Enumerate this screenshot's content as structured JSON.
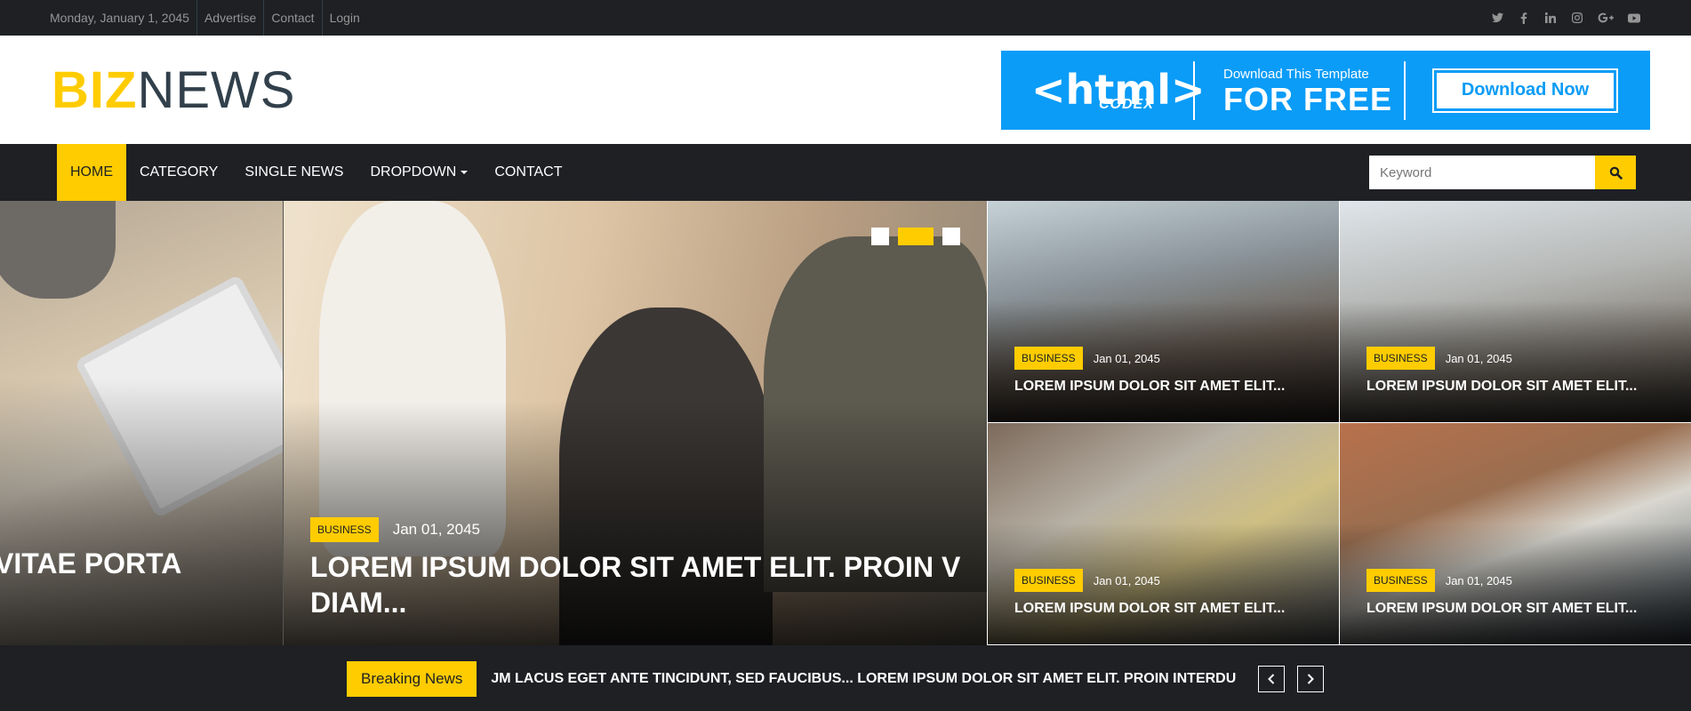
{
  "topbar": {
    "date": "Monday, January 1, 2045",
    "links": [
      "Advertise",
      "Contact",
      "Login"
    ],
    "social": [
      "twitter-icon",
      "facebook-icon",
      "linkedin-icon",
      "instagram-icon",
      "google-plus-icon",
      "youtube-icon"
    ]
  },
  "logo": {
    "part1": "BIZ",
    "part2": "NEWS"
  },
  "ad": {
    "brand": "<html>",
    "brand_sub": "CODEX",
    "line1": "Download This Template",
    "line2": "FOR FREE",
    "button": "Download Now"
  },
  "nav": {
    "items": [
      "HOME",
      "CATEGORY",
      "SINGLE NEWS",
      "DROPDOWN",
      "CONTACT"
    ],
    "search_placeholder": "Keyword"
  },
  "slider": {
    "prev_title": "VITAE PORTA",
    "category": "BUSINESS",
    "date": "Jan 01, 2045",
    "title_line1": "LOREM IPSUM DOLOR SIT AMET ELIT. PROIN V",
    "title_line2": "DIAM..."
  },
  "tiles": [
    {
      "category": "BUSINESS",
      "date": "Jan 01, 2045",
      "title": "LOREM IPSUM DOLOR SIT AMET ELIT..."
    },
    {
      "category": "BUSINESS",
      "date": "Jan 01, 2045",
      "title": "LOREM IPSUM DOLOR SIT AMET ELIT..."
    },
    {
      "category": "BUSINESS",
      "date": "Jan 01, 2045",
      "title": "LOREM IPSUM DOLOR SIT AMET ELIT..."
    },
    {
      "category": "BUSINESS",
      "date": "Jan 01, 2045",
      "title": "LOREM IPSUM DOLOR SIT AMET ELIT..."
    }
  ],
  "breaking": {
    "label": "Breaking News",
    "ticker": "JM LACUS EGET ANTE TINCIDUNT, SED FAUCIBUS... LOREM IPSUM DOLOR SIT AMET ELIT. PROIN INTERDU"
  },
  "colors": {
    "accent": "#ffcc00",
    "dark": "#1e2024",
    "ad_blue": "#0a9cf7"
  }
}
